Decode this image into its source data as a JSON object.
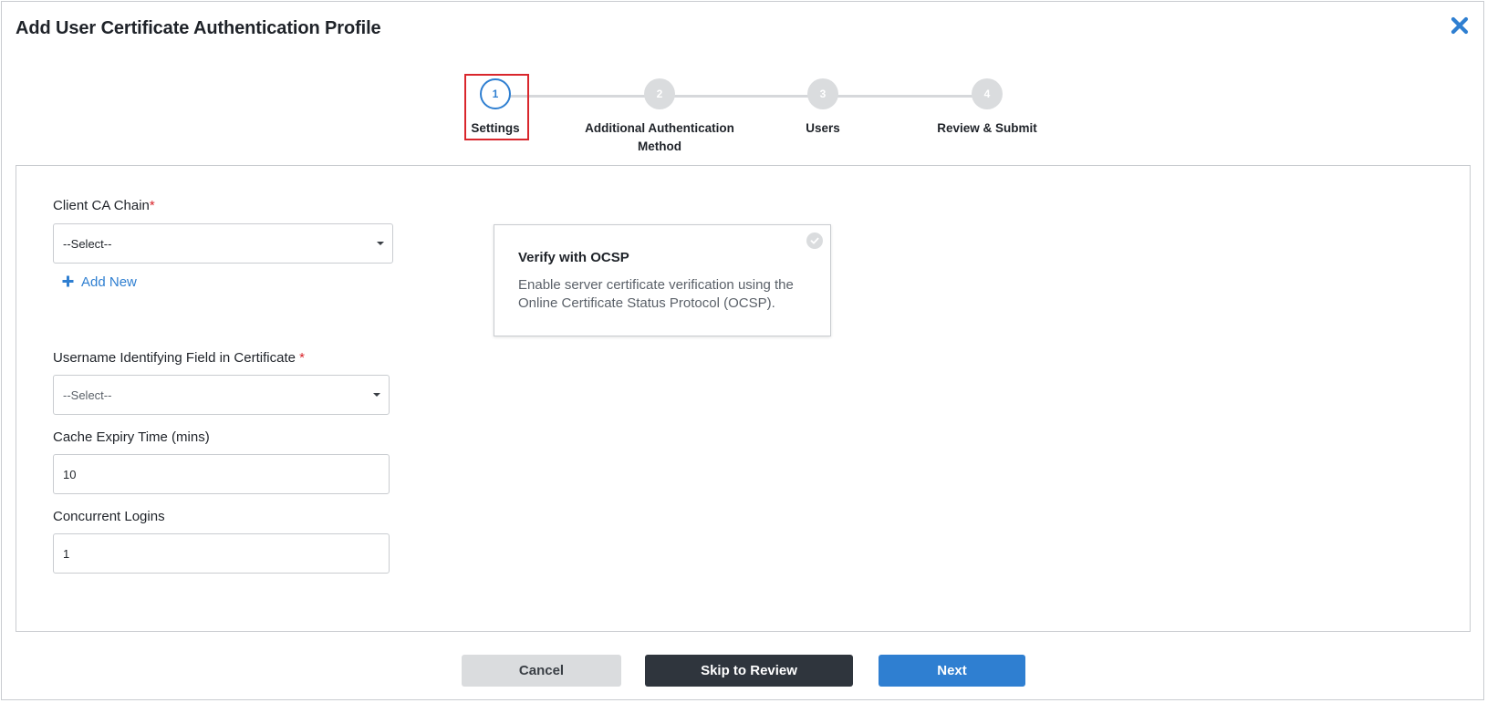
{
  "dialog": {
    "title": "Add User Certificate Authentication Profile"
  },
  "stepper": {
    "steps": [
      {
        "number": "1",
        "label": "Settings"
      },
      {
        "number": "2",
        "label": "Additional Authentication Method"
      },
      {
        "number": "3",
        "label": "Users"
      },
      {
        "number": "4",
        "label": "Review & Submit"
      }
    ]
  },
  "form": {
    "client_ca_chain": {
      "label": "Client CA Chain",
      "required_mark": "*",
      "value": "--Select--"
    },
    "add_new_label": "Add New",
    "username_field": {
      "label": "Username Identifying Field in Certificate",
      "required_mark": "*",
      "value": "--Select--"
    },
    "cache_expiry": {
      "label": "Cache Expiry Time (mins)",
      "value": "10"
    },
    "concurrent_logins": {
      "label": "Concurrent Logins",
      "value": "1"
    }
  },
  "ocsp_card": {
    "title": "Verify with OCSP",
    "description": "Enable server certificate verification using the Online Certificate Status Protocol (OCSP)."
  },
  "footer": {
    "cancel_label": "Cancel",
    "skip_label": "Skip to Review",
    "next_label": "Next"
  },
  "colors": {
    "accent": "#2f7fd1",
    "required": "#d9262c",
    "dark_button": "#2f353d",
    "highlight_box": "#d9262c"
  }
}
